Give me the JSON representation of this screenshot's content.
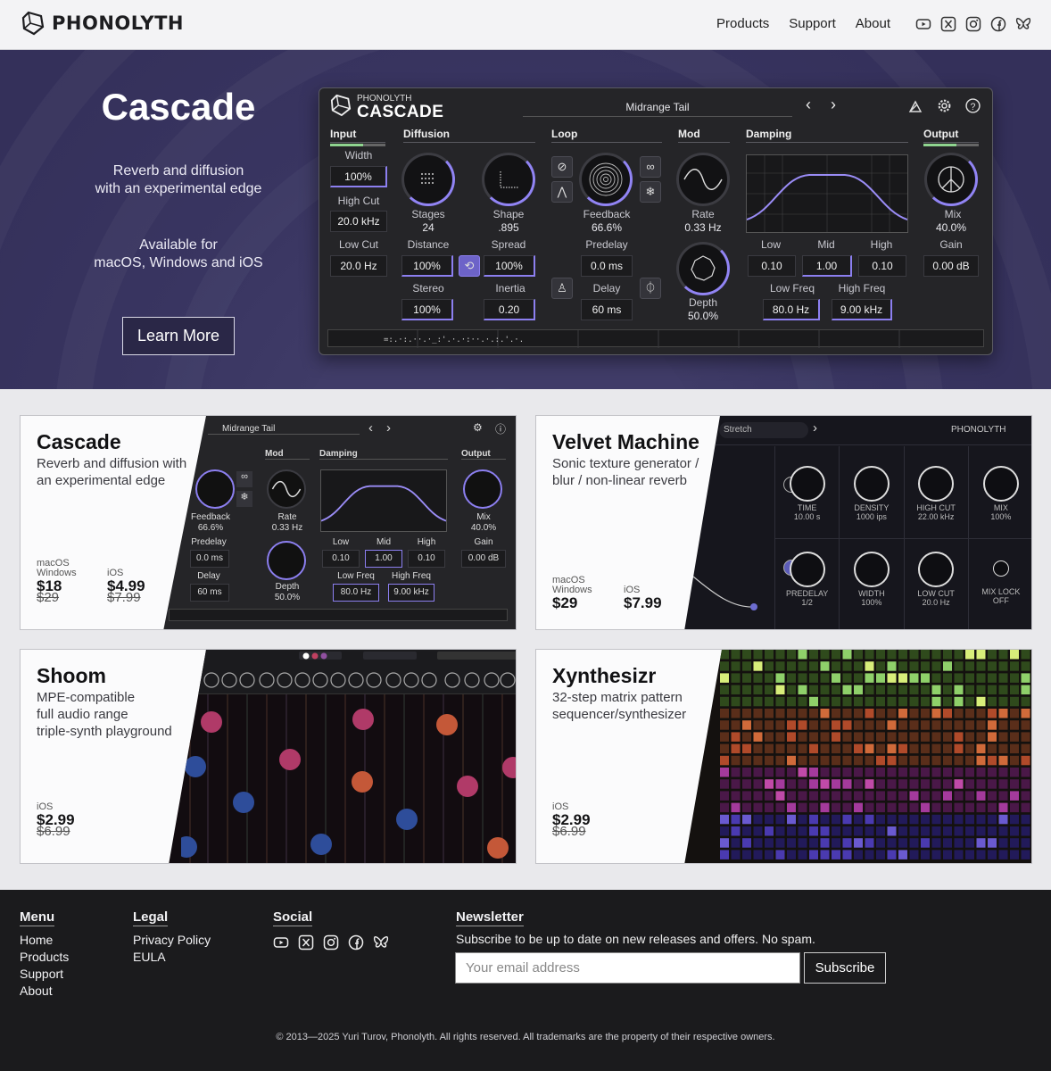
{
  "brand": {
    "name": "PHONOLYTH"
  },
  "nav": [
    "Products",
    "Support",
    "About"
  ],
  "social_icons": [
    "youtube-icon",
    "x-icon",
    "instagram-icon",
    "facebook-icon",
    "bluesky-icon"
  ],
  "hero": {
    "title": "Cascade",
    "subtitle": "Reverb and diffusion\nwith an experimental edge",
    "availability": "Available for\nmacOS, Windows and iOS",
    "button": "Learn More"
  },
  "plugin": {
    "maker": "PHONOLYTH",
    "product": "CASCADE",
    "preset": "Midrange Tail",
    "sections": {
      "input": "Input",
      "diffusion": "Diffusion",
      "loop": "Loop",
      "mod": "Mod",
      "damping": "Damping",
      "output": "Output"
    },
    "input": {
      "width_label": "Width",
      "width": "100%",
      "highcut_label": "High Cut",
      "highcut": "20.0 kHz",
      "lowcut_label": "Low Cut",
      "lowcut": "20.0 Hz"
    },
    "diffusion": {
      "stages_label": "Stages",
      "stages": "24",
      "shape_label": "Shape",
      "shape": ".895",
      "distance_label": "Distance",
      "distance": "100%",
      "spread_label": "Spread",
      "spread": "100%",
      "stereo_label": "Stereo",
      "stereo": "100%",
      "inertia_label": "Inertia",
      "inertia": "0.20"
    },
    "loop": {
      "feedback_label": "Feedback",
      "feedback": "66.6%",
      "predelay_label": "Predelay",
      "predelay": "0.0 ms",
      "delay_label": "Delay",
      "delay": "60 ms"
    },
    "mod": {
      "rate_label": "Rate",
      "rate": "0.33 Hz",
      "depth_label": "Depth",
      "depth": "50.0%"
    },
    "damping": {
      "low_label": "Low",
      "low": "0.10",
      "mid_label": "Mid",
      "mid": "1.00",
      "high_label": "High",
      "high": "0.10",
      "lowfreq_label": "Low Freq",
      "lowfreq": "80.0 Hz",
      "highfreq_label": "High Freq",
      "highfreq": "9.00 kHz"
    },
    "output": {
      "mix_label": "Mix",
      "mix": "40.0%",
      "gain_label": "Gain",
      "gain": "0.00 dB"
    }
  },
  "products": [
    {
      "name": "Cascade",
      "desc": "Reverb and diffusion with\nan experimental edge",
      "prices": [
        {
          "platform": "macOS\nWindows",
          "now": "$18",
          "old": "$29"
        },
        {
          "platform": "iOS",
          "now": "$4.99",
          "old": "$7.99"
        }
      ],
      "shot": {
        "preset": "Midrange Tail",
        "mod": "Mod",
        "damping": "Damping",
        "output": "Output",
        "feedback_label": "Feedback",
        "feedback": "66.6%",
        "rate_label": "Rate",
        "rate": "0.33 Hz",
        "mix_label": "Mix",
        "mix": "40.0%",
        "predelay_label": "Predelay",
        "predelay": "0.0 ms",
        "low_label": "Low",
        "low": "0.10",
        "mid_label": "Mid",
        "mid": "1.00",
        "high_label": "High",
        "high": "0.10",
        "gain_label": "Gain",
        "gain": "0.00 dB",
        "delay_label": "Delay",
        "delay": "60 ms",
        "depth_label": "Depth",
        "depth": "50.0%",
        "lowfreq_label": "Low Freq",
        "lowfreq": "80.0 Hz",
        "highfreq_label": "High Freq",
        "highfreq": "9.00 kHz"
      }
    },
    {
      "name": "Velvet Machine",
      "desc": "Sonic texture generator /\nblur / non-linear reverb",
      "prices": [
        {
          "platform": "macOS\nWindows",
          "now": "$29",
          "old": ""
        },
        {
          "platform": "iOS",
          "now": "$7.99",
          "old": ""
        }
      ],
      "shot": {
        "preset": "Stretch",
        "brand": "PHONOLYTH",
        "knobs": [
          {
            "label": "TIME",
            "value": "10.00 s"
          },
          {
            "label": "DENSITY",
            "value": "1000 ips"
          },
          {
            "label": "HIGH CUT",
            "value": "22.00 kHz"
          },
          {
            "label": "MIX",
            "value": "100%"
          },
          {
            "label": "PREDELAY",
            "value": "1/2"
          },
          {
            "label": "WIDTH",
            "value": "100%"
          },
          {
            "label": "LOW CUT",
            "value": "20.0 Hz"
          },
          {
            "label": "MIX LOCK",
            "value": "OFF"
          }
        ]
      }
    },
    {
      "name": "Shoom",
      "desc": "MPE-compatible\nfull audio range\ntriple-synth playground",
      "prices": [
        {
          "platform": "iOS",
          "now": "$2.99",
          "old": "$6.99"
        }
      ]
    },
    {
      "name": "Xynthesizr",
      "desc": "32-step matrix pattern\nsequencer/synthesizer",
      "prices": [
        {
          "platform": "iOS",
          "now": "$2.99",
          "old": "$6.99"
        }
      ]
    }
  ],
  "footer": {
    "menu_title": "Menu",
    "menu": [
      "Home",
      "Products",
      "Support",
      "About"
    ],
    "legal_title": "Legal",
    "legal": [
      "Privacy Policy",
      "EULA"
    ],
    "social_title": "Social",
    "newsletter_title": "Newsletter",
    "newsletter_text": "Subscribe to be up to date on new releases and offers. No spam.",
    "email_placeholder": "Your email address",
    "subscribe": "Subscribe",
    "copyright": "© 2013—2025 Yuri Turov, Phonolyth. All rights reserved. All trademarks are the property of their respective owners."
  },
  "colors": {
    "accent": "#9184f4",
    "hero_bg": "#3b3763",
    "footer_bg": "#1b1b1d"
  }
}
